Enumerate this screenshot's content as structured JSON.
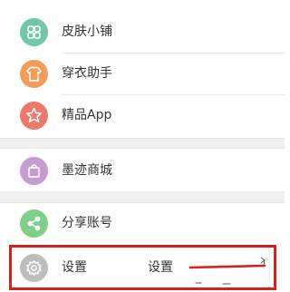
{
  "menu": {
    "items": [
      {
        "label": "皮肤小铺",
        "icon": "clover-icon",
        "color": "#6fc8a8"
      },
      {
        "label": "穿衣助手",
        "icon": "shirt-icon",
        "color": "#f39c5a"
      },
      {
        "label": "精品App",
        "icon": "star-icon",
        "color": "#ee7a6b"
      },
      {
        "label": "墨迹商城",
        "icon": "shopping-bag-icon",
        "color": "#c99bd3"
      },
      {
        "label": "分享账号",
        "icon": "share-icon",
        "color": "#7fcf88"
      },
      {
        "label": "设置",
        "icon": "gear-icon",
        "color": "#bdbdbd"
      }
    ]
  },
  "annotation": {
    "text": "设置",
    "color": "#d6201f"
  },
  "colors": {
    "background": "#ffffff",
    "section_gap": "#f1f1f1",
    "text": "#333333",
    "divider": "#e8e8e8"
  }
}
